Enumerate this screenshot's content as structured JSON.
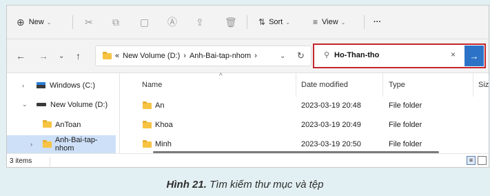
{
  "toolbar": {
    "new_label": "New",
    "sort_label": "Sort",
    "view_label": "View",
    "more_label": "···"
  },
  "address": {
    "overflow": "«",
    "crumbs": [
      "New Volume (D:)",
      "Anh-Bai-tap-nhom"
    ],
    "sep": "›"
  },
  "search": {
    "value": "Ho-Than-tho",
    "clear": "×"
  },
  "nav": {
    "items": [
      {
        "label": "Windows (C:)"
      },
      {
        "label": "New Volume (D:)"
      },
      {
        "label": "AnToan"
      },
      {
        "label": "Anh-Bai-tap-nhom"
      }
    ]
  },
  "list": {
    "columns": [
      "Name",
      "Date modified",
      "Type",
      "Siz"
    ],
    "rows": [
      {
        "name": "An",
        "date": "2023-03-19 20:48",
        "type": "File folder"
      },
      {
        "name": "Khoa",
        "date": "2023-03-19 20:49",
        "type": "File folder"
      },
      {
        "name": "Minh",
        "date": "2023-03-19 20:50",
        "type": "File folder"
      }
    ]
  },
  "status": {
    "count": "3 items"
  },
  "caption": {
    "bold": "Hình 21.",
    "text": " Tìm kiếm thư mục và tệp"
  },
  "colors": {
    "accent": "#2c73c7",
    "highlight_border": "#c5252d",
    "selected": "#cde0f7",
    "folder": "#f6c343"
  }
}
